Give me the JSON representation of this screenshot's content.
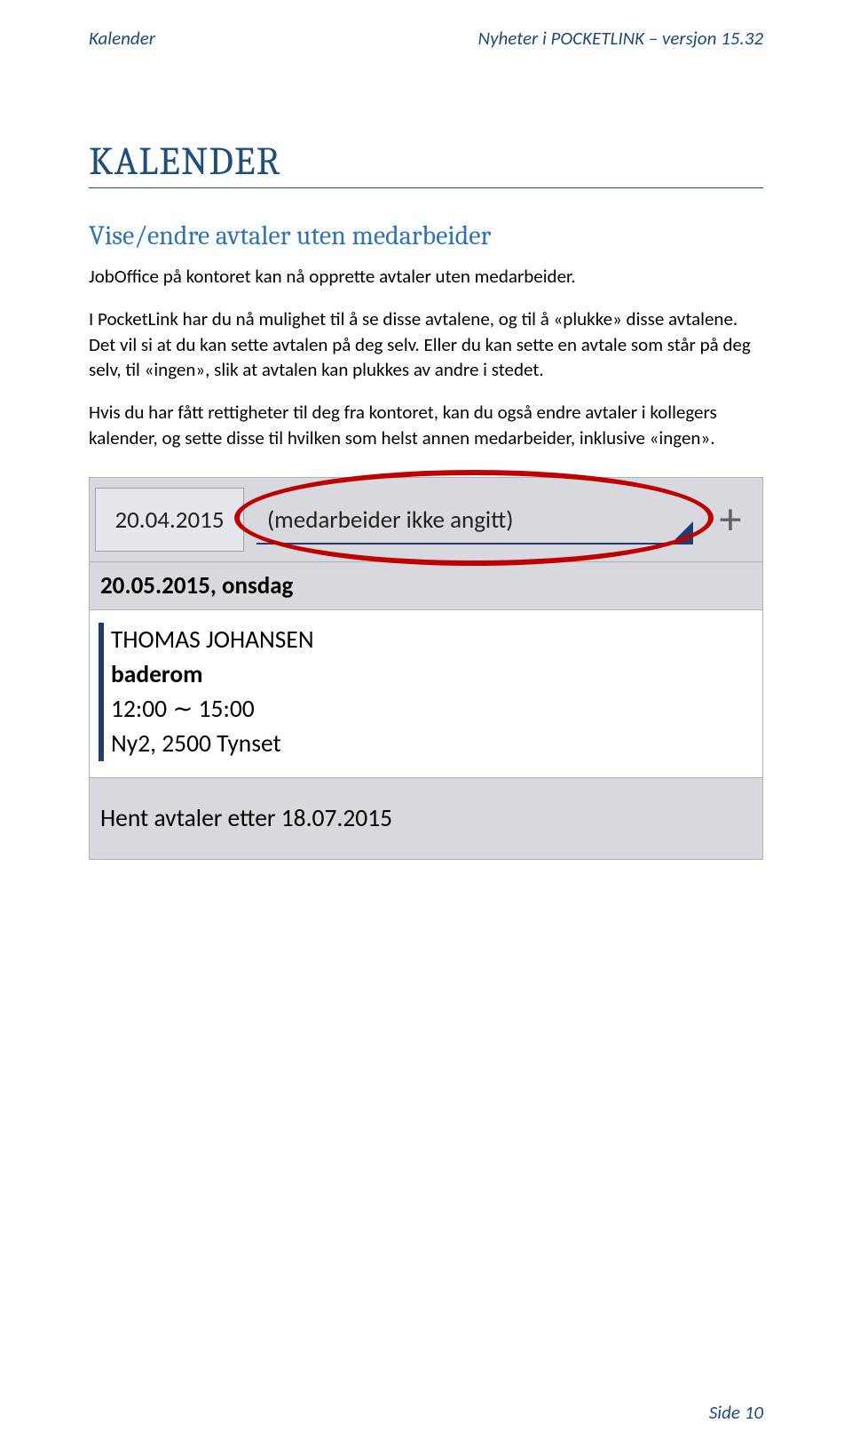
{
  "header": {
    "left": "Kalender",
    "right": "Nyheter i POCKETLINK – versjon 15.32"
  },
  "title": "KALENDER",
  "subtitle": "Vise/endre avtaler uten medarbeider",
  "paragraphs": {
    "p1": "JobOffice på kontoret kan nå opprette avtaler uten medarbeider.",
    "p2": "I PocketLink har du nå mulighet til å se disse avtalene, og til å «plukke» disse avtalene. Det vil si at du kan sette avtalen på deg selv. Eller du kan sette en avtale som står på deg selv, til «ingen», slik at avtalen kan plukkes av andre i stedet.",
    "p3": "Hvis du har fått rettigheter til deg fra kontoret, kan du også endre avtaler i kollegers kalender, og sette disse til hvilken som helst annen medarbeider, inklusive «ingen»."
  },
  "screenshot": {
    "date_button": "20.04.2015",
    "employee_dropdown": "(medarbeider ikke angitt)",
    "plus": "+",
    "day_header": "20.05.2015, onsdag",
    "entry": {
      "customer": "THOMAS JOHANSEN",
      "subject": "baderom",
      "time": "12:00  ∼  15:00",
      "address": "Ny2, 2500 Tynset"
    },
    "fetch_bar": "Hent avtaler etter 18.07.2015"
  },
  "footer": {
    "page": "Side 10"
  }
}
